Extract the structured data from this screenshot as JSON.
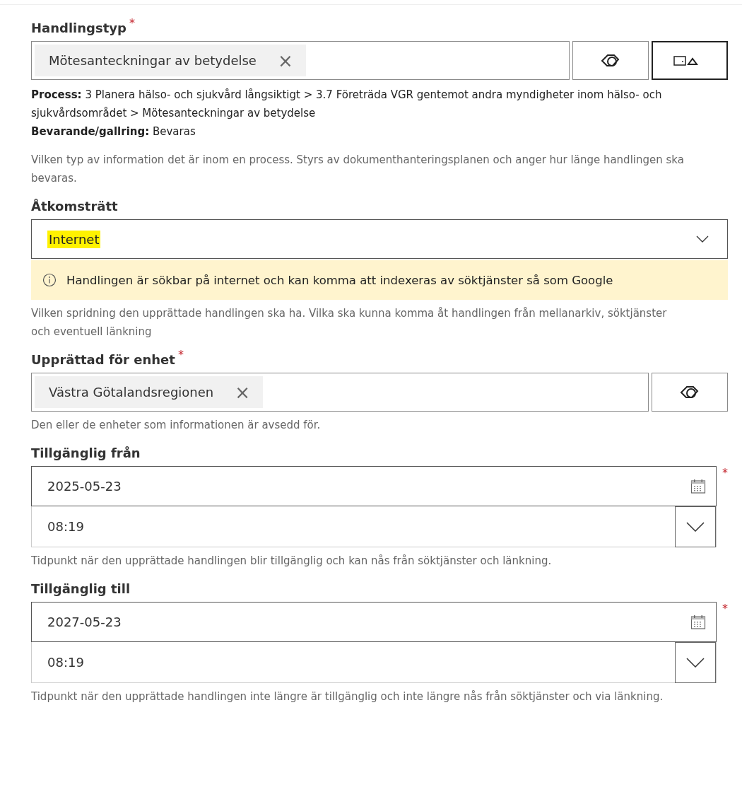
{
  "fields": [
    {
      "kind": "taxonomy",
      "label": "Handlingstyp",
      "required_mark": "*",
      "tag": {
        "text": "Mötesanteckningar av betydelse",
        "remove": "×"
      },
      "extra_button": true,
      "details": [
        {
          "term": "Process:",
          "text": "3 Planera hälso- och sjukvård långsiktigt > 3.7 Företräda VGR gentemot andra myndigheter inom hälso- och sjukvårdsområdet > Mötesanteckningar av betydelse"
        },
        {
          "term": "Bevarande/gallring:",
          "text": "Bevaras"
        }
      ],
      "description": "Vilken typ av information det är inom en process. Styrs av dokumenthanteringsplanen och anger hur länge handlingen ska bevaras."
    },
    {
      "kind": "dropdown",
      "label": "Åtkomsträtt",
      "value": "Internet",
      "highlighted": true,
      "warning": "Handlingen är sökbar på internet och kan komma att indexeras av söktjänster så som Google",
      "description": "Vilken spridning den upprättade handlingen ska ha. Vilka ska kunna komma åt handlingen från mellanarkiv, söktjänster och eventuell länkning"
    },
    {
      "kind": "taxonomy",
      "label": "Upprättad för enhet",
      "required_mark": "*",
      "tag": {
        "text": "Västra Götalandsregionen",
        "remove": "×"
      },
      "extra_button": false,
      "description": "Den eller de enheter som informationen är avsedd för."
    },
    {
      "kind": "datetime",
      "label": "Tillgänglig från",
      "date": "2025-05-23",
      "time": "08:19",
      "date_mark": "*",
      "description": "Tidpunkt när den upprättade handlingen blir tillgänglig och kan nås från söktjänster och länkning."
    },
    {
      "kind": "datetime",
      "label": "Tillgänglig till",
      "date": "2027-05-23",
      "time": "08:19",
      "date_mark": "*",
      "description": "Tidpunkt när den upprättade handlingen inte längre är tillgänglig och inte längre nås från söktjänster och via länkning."
    }
  ]
}
